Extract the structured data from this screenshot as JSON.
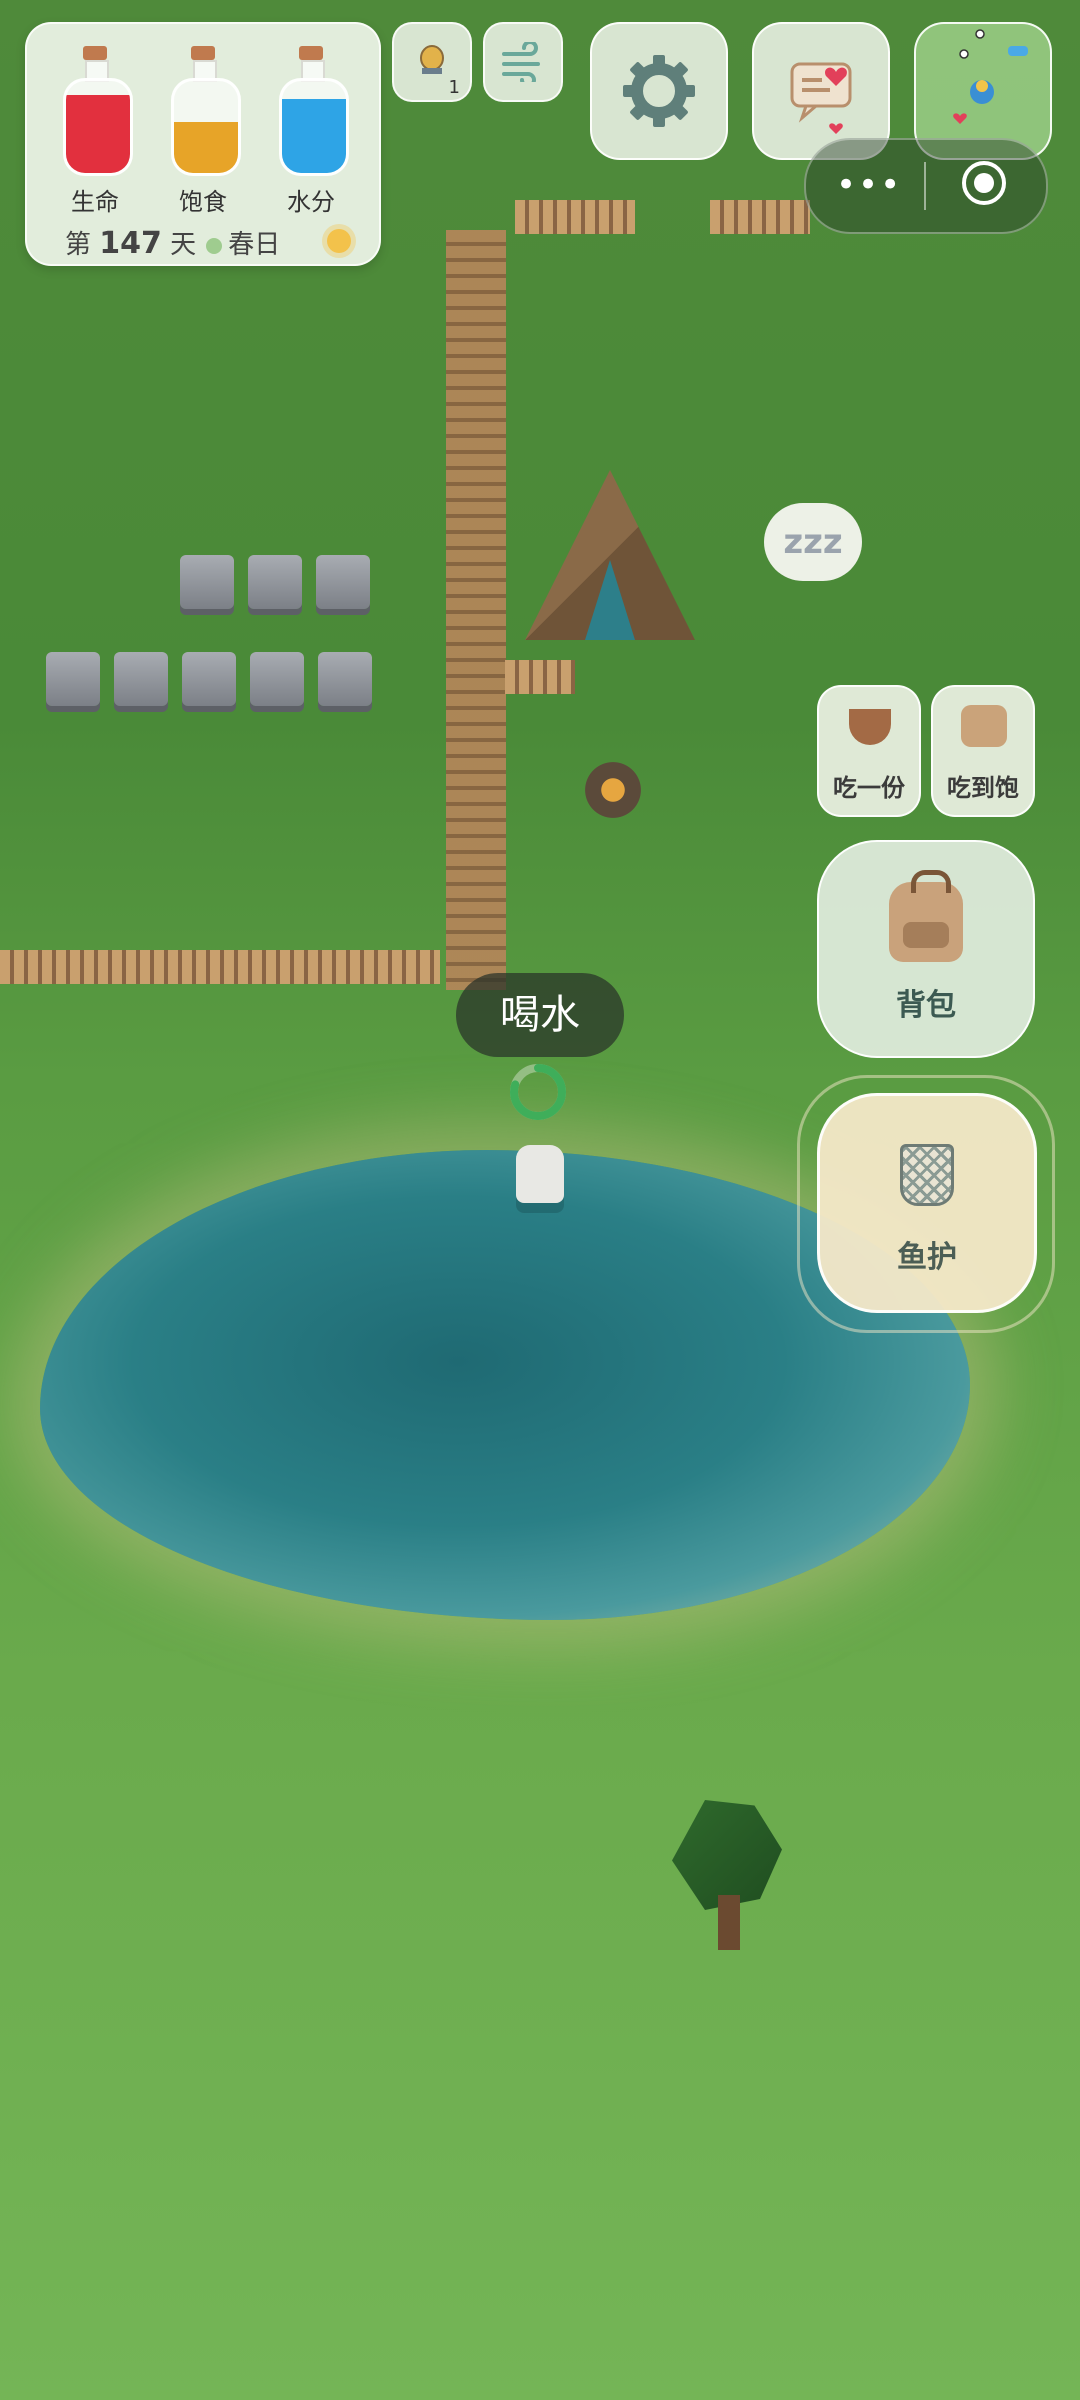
{
  "status": {
    "bottles": [
      {
        "label": "生命",
        "color": "#e2303e",
        "level": 0.85
      },
      {
        "label": "饱食",
        "color": "#e7a428",
        "level": 0.55
      },
      {
        "label": "水分",
        "color": "#2ea4e6",
        "level": 0.8
      }
    ],
    "day_prefix": "第",
    "day_number": "147",
    "day_suffix": "天",
    "season": "春日"
  },
  "top_buttons": {
    "beehive_count": "1",
    "wind_icon": "wind-icon",
    "settings_icon": "gear-icon",
    "chat_icon": "chat-heart-icon"
  },
  "capsule": {
    "more": "•••",
    "close_icon": "target-icon"
  },
  "sleep_bubble": "zzz",
  "actions": {
    "eat_one": "吃一份",
    "eat_full": "吃到饱",
    "backpack": "背包",
    "fish_guard": "鱼护",
    "drink": "喝水"
  },
  "colors": {
    "accent_green": "#3fae5a",
    "panel_bg": "#eef4e8"
  }
}
